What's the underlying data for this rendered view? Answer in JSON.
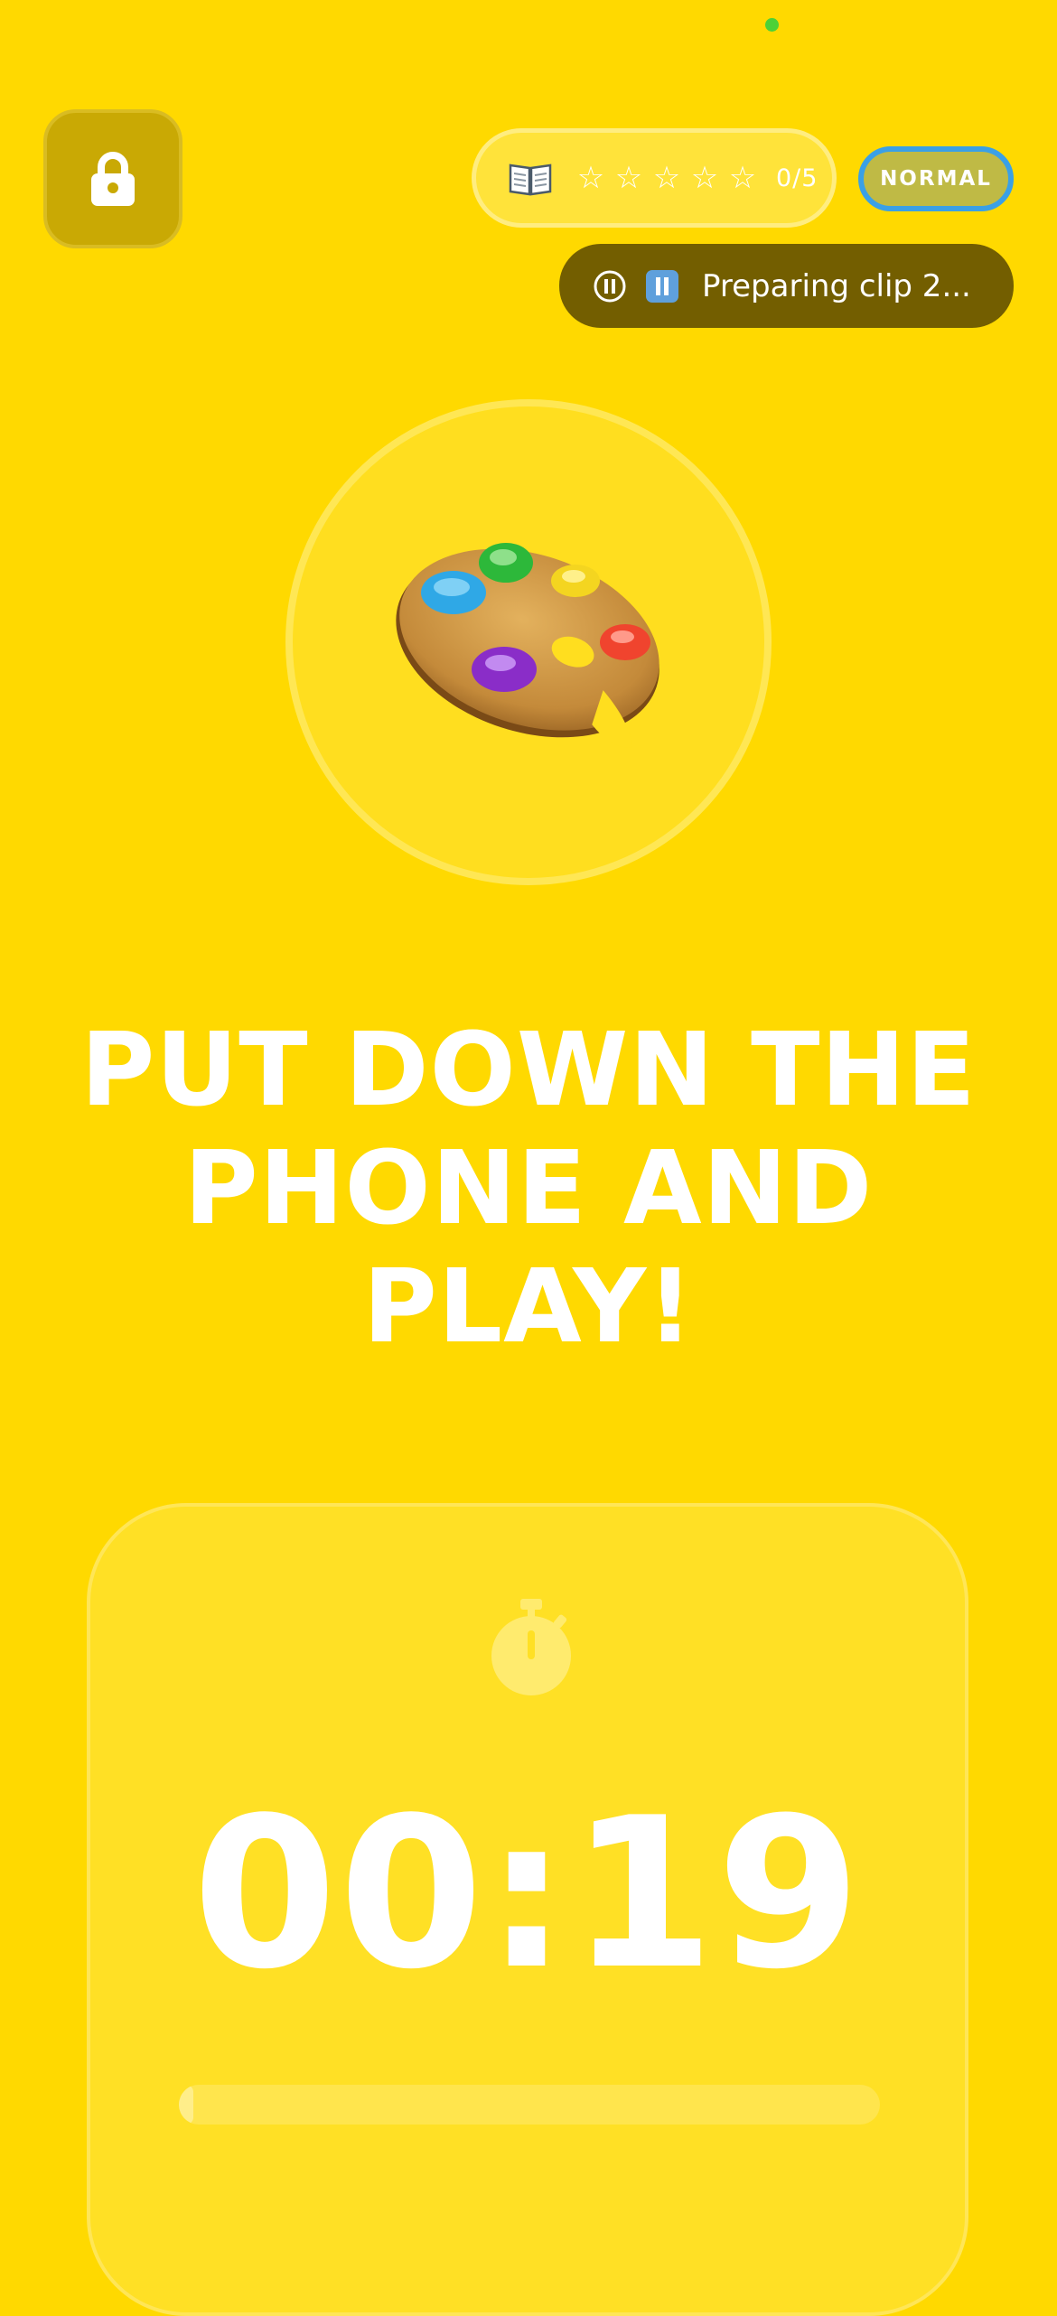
{
  "header": {
    "lock_icon": "lock-icon",
    "progress": {
      "book_icon": "book-icon",
      "stars_total": 5,
      "stars_filled": 0,
      "count": "0/5"
    },
    "mode": "NORMAL"
  },
  "clip_status": {
    "label": "Preparing clip 2...",
    "icons": [
      "pause-circle-icon",
      "pause-button-icon"
    ]
  },
  "activity": {
    "icon": "artist-palette-icon",
    "headline": "PUT DOWN THE PHONE AND PLAY!"
  },
  "timer": {
    "icon": "stopwatch-icon",
    "value": "00:19",
    "progress_fraction": 0.02
  },
  "colors": {
    "background": "#FFD900",
    "status_dot": "#4CD137",
    "mode_border": "#3AA0E6",
    "clip_pill": "#735E00"
  }
}
